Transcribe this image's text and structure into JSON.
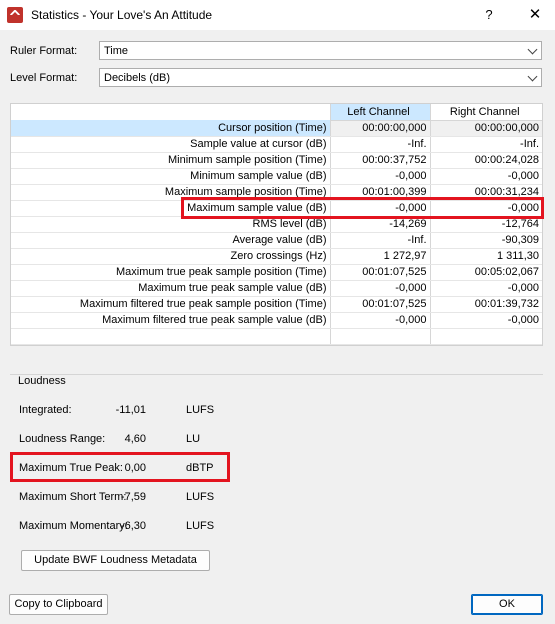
{
  "window": {
    "title": "Statistics - Your Love's An Attitude",
    "help_label": "?",
    "close_label": "✕"
  },
  "formats": {
    "ruler_label": "Ruler Format:",
    "ruler_value": "Time",
    "level_label": "Level Format:",
    "level_value": "Decibels (dB)"
  },
  "table": {
    "headers": {
      "left": "Left Channel",
      "right": "Right Channel"
    },
    "rows": [
      {
        "label": "Cursor position (Time)",
        "left": "00:00:00,000",
        "right": "00:00:00,000"
      },
      {
        "label": "Sample value at cursor (dB)",
        "left": "-Inf.",
        "right": "-Inf."
      },
      {
        "label": "Minimum sample position (Time)",
        "left": "00:00:37,752",
        "right": "00:00:24,028"
      },
      {
        "label": "Minimum sample value (dB)",
        "left": "-0,000",
        "right": "-0,000"
      },
      {
        "label": "Maximum sample position (Time)",
        "left": "00:01:00,399",
        "right": "00:00:31,234"
      },
      {
        "label": "Maximum sample value (dB)",
        "left": "-0,000",
        "right": "-0,000"
      },
      {
        "label": "RMS level (dB)",
        "left": "-14,269",
        "right": "-12,764"
      },
      {
        "label": "Average value (dB)",
        "left": "-Inf.",
        "right": "-90,309"
      },
      {
        "label": "Zero crossings (Hz)",
        "left": "1 272,97",
        "right": "1 311,30"
      },
      {
        "label": "Maximum true peak sample position (Time)",
        "left": "00:01:07,525",
        "right": "00:05:02,067"
      },
      {
        "label": "Maximum true peak sample value (dB)",
        "left": "-0,000",
        "right": "-0,000"
      },
      {
        "label": "Maximum filtered true peak sample position (Time)",
        "left": "00:01:07,525",
        "right": "00:01:39,732"
      },
      {
        "label": "Maximum filtered true peak sample value (dB)",
        "left": "-0,000",
        "right": "-0,000"
      }
    ]
  },
  "loudness": {
    "title": "Loudness",
    "items": [
      {
        "label": "Integrated:",
        "value": "-11,01",
        "unit": "LUFS"
      },
      {
        "label": "Loudness Range:",
        "value": "4,60",
        "unit": "LU"
      },
      {
        "label": "Maximum True Peak:",
        "value": "0,00",
        "unit": "dBTP"
      },
      {
        "label": "Maximum Short Term:",
        "value": "-7,59",
        "unit": "LUFS"
      },
      {
        "label": "Maximum Momentary:",
        "value": "-6,30",
        "unit": "LUFS"
      }
    ],
    "update_button": "Update BWF Loudness Metadata"
  },
  "footer": {
    "copy_button": "Copy to Clipboard",
    "ok_button": "OK"
  },
  "colors": {
    "highlight": "#e3141f",
    "selection": "#cce8ff",
    "app_icon": "#c0322b"
  },
  "icons": [
    "app-icon",
    "help-icon",
    "close-icon",
    "chevron-down-icon"
  ]
}
